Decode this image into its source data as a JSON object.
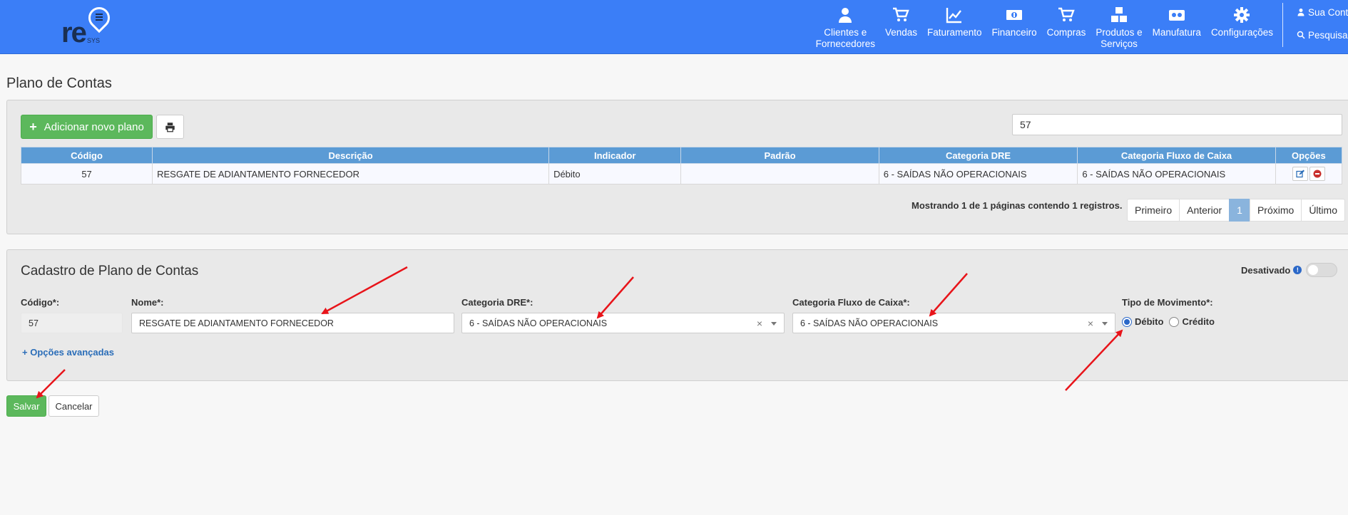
{
  "nav": {
    "items": [
      {
        "label": "Clientes e Fornecedores",
        "line1": "Clientes e",
        "line2": "Fornecedores",
        "icon": "user-icon"
      },
      {
        "label": "Vendas",
        "line1": "Vendas",
        "line2": "",
        "icon": "cart-icon"
      },
      {
        "label": "Faturamento",
        "line1": "Faturamento",
        "line2": "",
        "icon": "line-chart-icon"
      },
      {
        "label": "Financeiro",
        "line1": "Financeiro",
        "line2": "",
        "icon": "money-icon"
      },
      {
        "label": "Compras",
        "line1": "Compras",
        "line2": "",
        "icon": "cart-icon"
      },
      {
        "label": "Produtos e Serviços",
        "line1": "Produtos e",
        "line2": "Serviços",
        "icon": "cubes-icon"
      },
      {
        "label": "Manufatura",
        "line1": "Manufatura",
        "line2": "",
        "icon": "industry-icon"
      },
      {
        "label": "Configurações",
        "line1": "Configurações",
        "line2": "",
        "icon": "gear-icon"
      }
    ],
    "account_label": "Sua Conta",
    "search_label": "Pesquisar"
  },
  "logo": {
    "main": "re",
    "sub": "SYS"
  },
  "page_title": "Plano de Contas",
  "list": {
    "add_button": "Adicionar novo plano",
    "search_value": "57",
    "columns": [
      "Código",
      "Descrição",
      "Indicador",
      "Padrão",
      "Categoria DRE",
      "Categoria Fluxo de Caixa",
      "Opções"
    ],
    "rows": [
      {
        "codigo": "57",
        "descricao": "RESGATE DE ADIANTAMENTO FORNECEDOR",
        "indicador": "Débito",
        "padrao": "",
        "categoria_dre": "6 - SAÍDAS NÃO OPERACIONAIS",
        "categoria_fluxo": "6 - SAÍDAS NÃO OPERACIONAIS"
      }
    ],
    "pager_info": "Mostrando 1 de 1 páginas contendo 1 registros.",
    "pager": {
      "first": "Primeiro",
      "prev": "Anterior",
      "current": "1",
      "next": "Próximo",
      "last": "Último"
    }
  },
  "form": {
    "title": "Cadastro de Plano de Contas",
    "desativado_label": "Desativado",
    "codigo_label": "Código*:",
    "codigo_value": "57",
    "nome_label": "Nome*:",
    "nome_value": "RESGATE DE ADIANTAMENTO FORNECEDOR",
    "dre_label": "Categoria DRE*:",
    "dre_value": "6 - SAÍDAS NÃO OPERACIONAIS",
    "fluxo_label": "Categoria Fluxo de Caixa*:",
    "fluxo_value": "6 - SAÍDAS NÃO OPERACIONAIS",
    "tipo_label": "Tipo de Movimento*:",
    "debito_label": "Débito",
    "credito_label": "Crédito",
    "selected_tipo": "Débito",
    "advanced_label": "Opções avançadas",
    "clear_glyph": "×"
  },
  "actions": {
    "save": "Salvar",
    "cancel": "Cancelar"
  },
  "colors": {
    "navbar": "#3b7ef7",
    "success": "#5cb85c",
    "table_header": "#5b9bd5",
    "annotation_arrow": "#e8141a"
  }
}
